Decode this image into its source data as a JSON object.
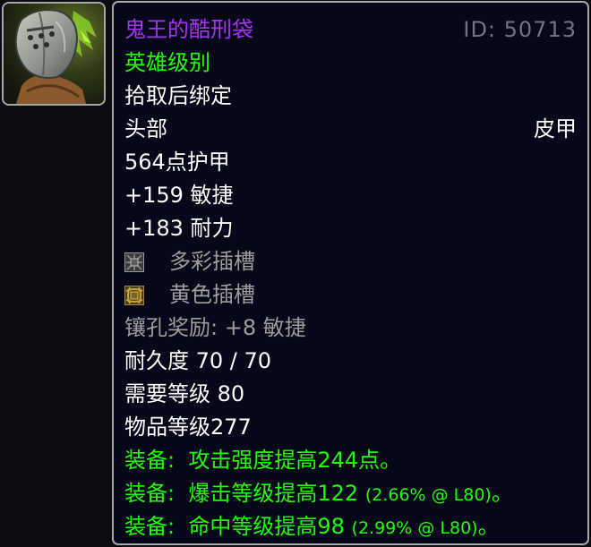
{
  "item": {
    "name": "鬼王的酷刑袋",
    "id_text": "ID: 50713",
    "mode": "英雄级别",
    "binding": "拾取后绑定",
    "slot": "头部",
    "armor_type": "皮甲",
    "armor": "564点护甲",
    "stats": [
      "+159 敏捷",
      "+183 耐力"
    ],
    "sockets": [
      {
        "label": "多彩插槽",
        "icon": "meta-socket-icon"
      },
      {
        "label": "黄色插槽",
        "icon": "yellow-socket-icon"
      }
    ],
    "socket_bonus": "镶孔奖励: +8 敏捷",
    "durability": "耐久度 70 / 70",
    "required_level": "需要等级 80",
    "item_level": "物品等级277",
    "equip_effects": [
      {
        "prefix": "装备:",
        "text": "攻击强度提高244点。",
        "detail": "",
        "suffix": ""
      },
      {
        "prefix": "装备:",
        "text": "爆击等级提高122",
        "detail": "(2.66% @ L80)",
        "suffix": "。"
      },
      {
        "prefix": "装备:",
        "text": "命中等级提高98",
        "detail": "(2.99% @ L80)",
        "suffix": "。"
      }
    ]
  },
  "colors": {
    "epic": "#a335ee",
    "uncommon": "#1eff00",
    "white": "#ffffff",
    "grey": "#9d9d9d",
    "background": "#07071a",
    "border": "#a8a8a8"
  },
  "icons": {
    "item": "hooded-helm-icon",
    "meta_socket": "meta-socket-icon",
    "yellow_socket": "yellow-socket-icon"
  }
}
